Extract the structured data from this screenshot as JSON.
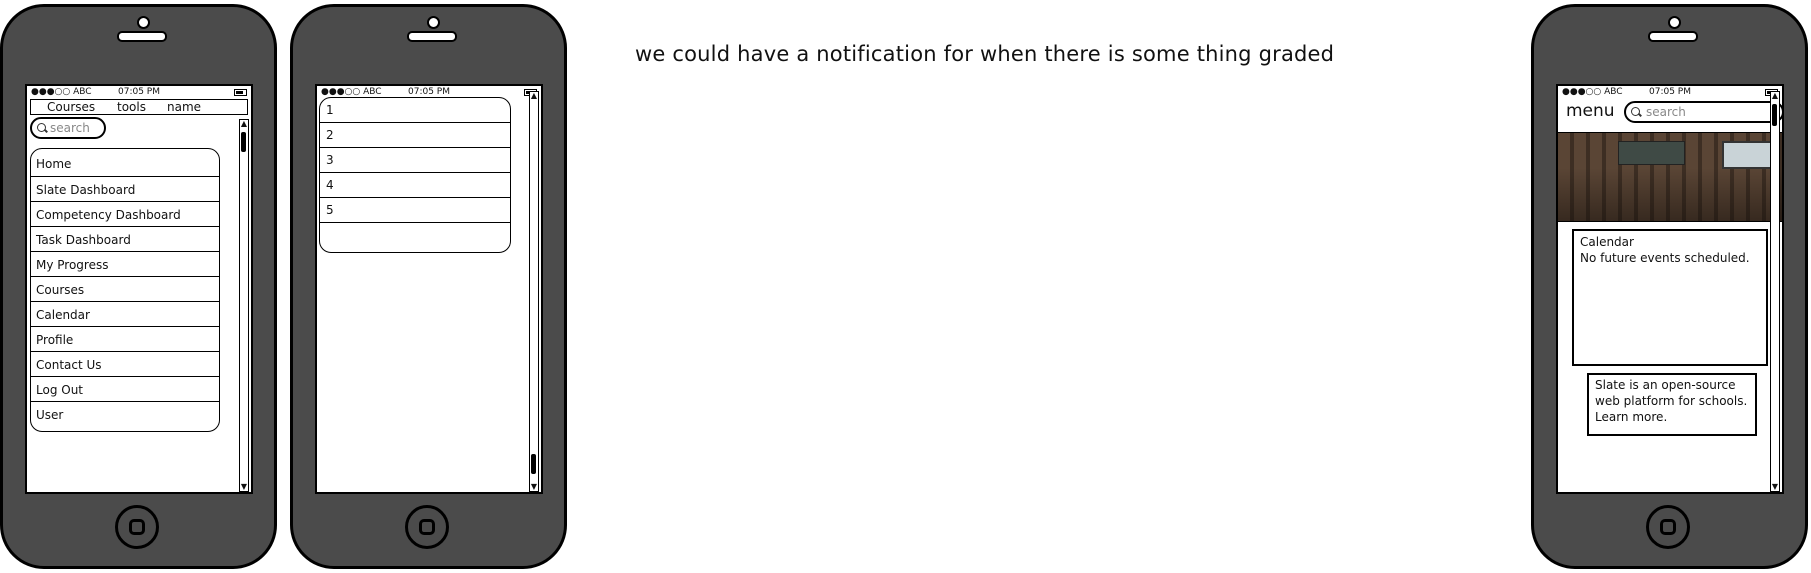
{
  "status_bar": {
    "carrier": "●●●○○ ABC",
    "time": "07:05 PM"
  },
  "phone1": {
    "tabs": [
      "Courses",
      "tools",
      "name"
    ],
    "search_placeholder": "search",
    "menu": [
      "Home",
      "Slate Dashboard",
      "Competency Dashboard",
      "Task Dashboard",
      "My Progress",
      "Courses",
      "Calendar",
      "Profile",
      "Contact Us",
      "Log Out",
      "User"
    ]
  },
  "phone2": {
    "items": [
      "1",
      "2",
      "3",
      "4",
      "5",
      ""
    ]
  },
  "note": "we could have a notification for when there is some thing graded",
  "phone3": {
    "menu_label": "menu",
    "search_placeholder": "search",
    "calendar": {
      "title": "Calendar",
      "text": "No future events scheduled."
    },
    "info": {
      "line1": "Slate is an open-source",
      "line2": "web platform for schools.",
      "line3": "Learn more."
    }
  }
}
